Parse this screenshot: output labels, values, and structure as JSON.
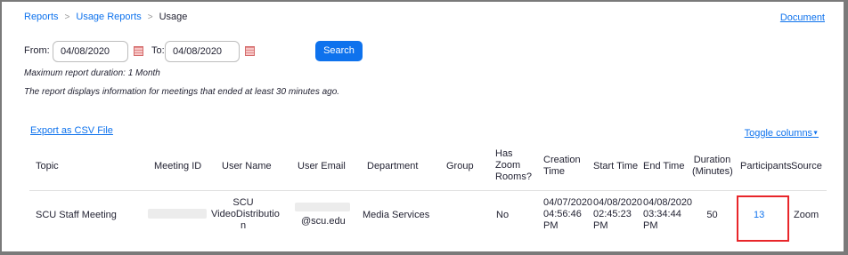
{
  "breadcrumb": {
    "items": [
      "Reports",
      "Usage Reports"
    ],
    "current": "Usage",
    "separator": ">"
  },
  "header": {
    "document_link": "Document"
  },
  "filters": {
    "from_label": "From:",
    "from_value": "04/08/2020",
    "to_label": "To:",
    "to_value": "04/08/2020",
    "search_label": "Search",
    "note_max_duration": "Maximum report duration: 1 Month",
    "note_meetings": "The report displays information for meetings that ended at least 30 minutes ago."
  },
  "actions": {
    "export_label": "Export as CSV File",
    "toggle_label": "Toggle columns"
  },
  "table": {
    "headers": {
      "topic": "Topic",
      "meeting_id": "Meeting ID",
      "user_name": "User Name",
      "user_email": "User Email",
      "department": "Department",
      "group": "Group",
      "has_zoom_rooms": [
        "Has",
        "Zoom",
        "Rooms?"
      ],
      "creation_time": [
        "Creation",
        "Time"
      ],
      "start_time": "Start Time",
      "end_time": "End Time",
      "duration": [
        "Duration",
        "(Minutes)"
      ],
      "participants": "Participants",
      "source": "Source"
    },
    "row": {
      "topic": "SCU Staff Meeting",
      "user_name": [
        "SCU",
        "VideoDistributio",
        "n"
      ],
      "user_email": "@scu.edu",
      "department": "Media Services",
      "group": "",
      "has_zoom_rooms": "No",
      "creation_time": [
        "04/07/2020",
        "04:56:46",
        "PM"
      ],
      "start_time": [
        "04/08/2020",
        "02:45:23",
        "PM"
      ],
      "end_time": [
        "04/08/2020",
        "03:34:44",
        "PM"
      ],
      "duration": "50",
      "participants": "13",
      "source": "Zoom"
    }
  },
  "colors": {
    "link": "#0e72ed",
    "button": "#0e72ed",
    "highlight": "#e8262a"
  }
}
